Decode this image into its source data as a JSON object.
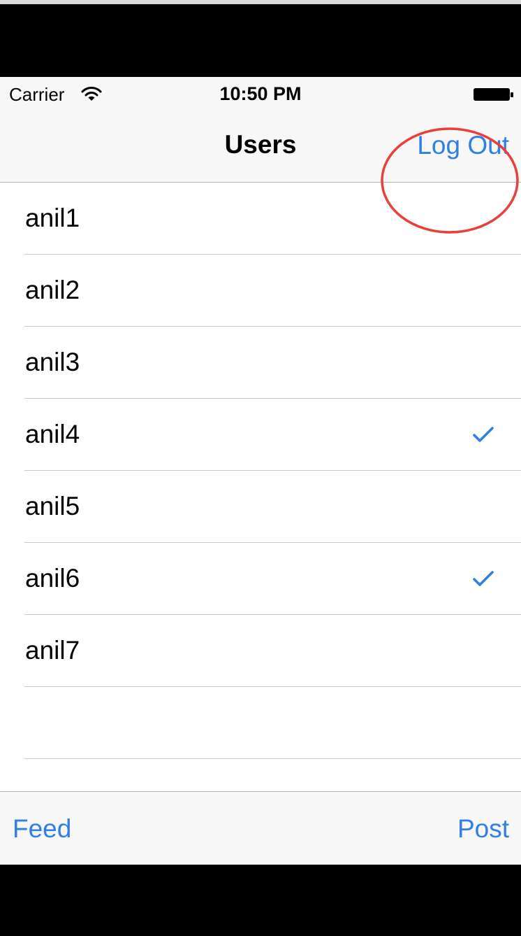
{
  "status_bar": {
    "carrier": "Carrier",
    "time": "10:50 PM",
    "icons": [
      "wifi-icon",
      "battery-icon"
    ]
  },
  "nav_bar": {
    "title": "Users",
    "right_button": "Log Out",
    "right_button_highlighted": true
  },
  "users": [
    {
      "name": "anil1",
      "checked": false
    },
    {
      "name": "anil2",
      "checked": false
    },
    {
      "name": "anil3",
      "checked": false
    },
    {
      "name": "anil4",
      "checked": true
    },
    {
      "name": "anil5",
      "checked": false
    },
    {
      "name": "anil6",
      "checked": true
    },
    {
      "name": "anil7",
      "checked": false
    },
    {
      "name": "",
      "checked": false
    }
  ],
  "toolbar": {
    "left_button": "Feed",
    "right_button": "Post"
  },
  "colors": {
    "tint": "#2f7fe6",
    "annotation": "#e8413b",
    "bar_background": "#f7f7f7",
    "separator": "#c8c7cc"
  }
}
